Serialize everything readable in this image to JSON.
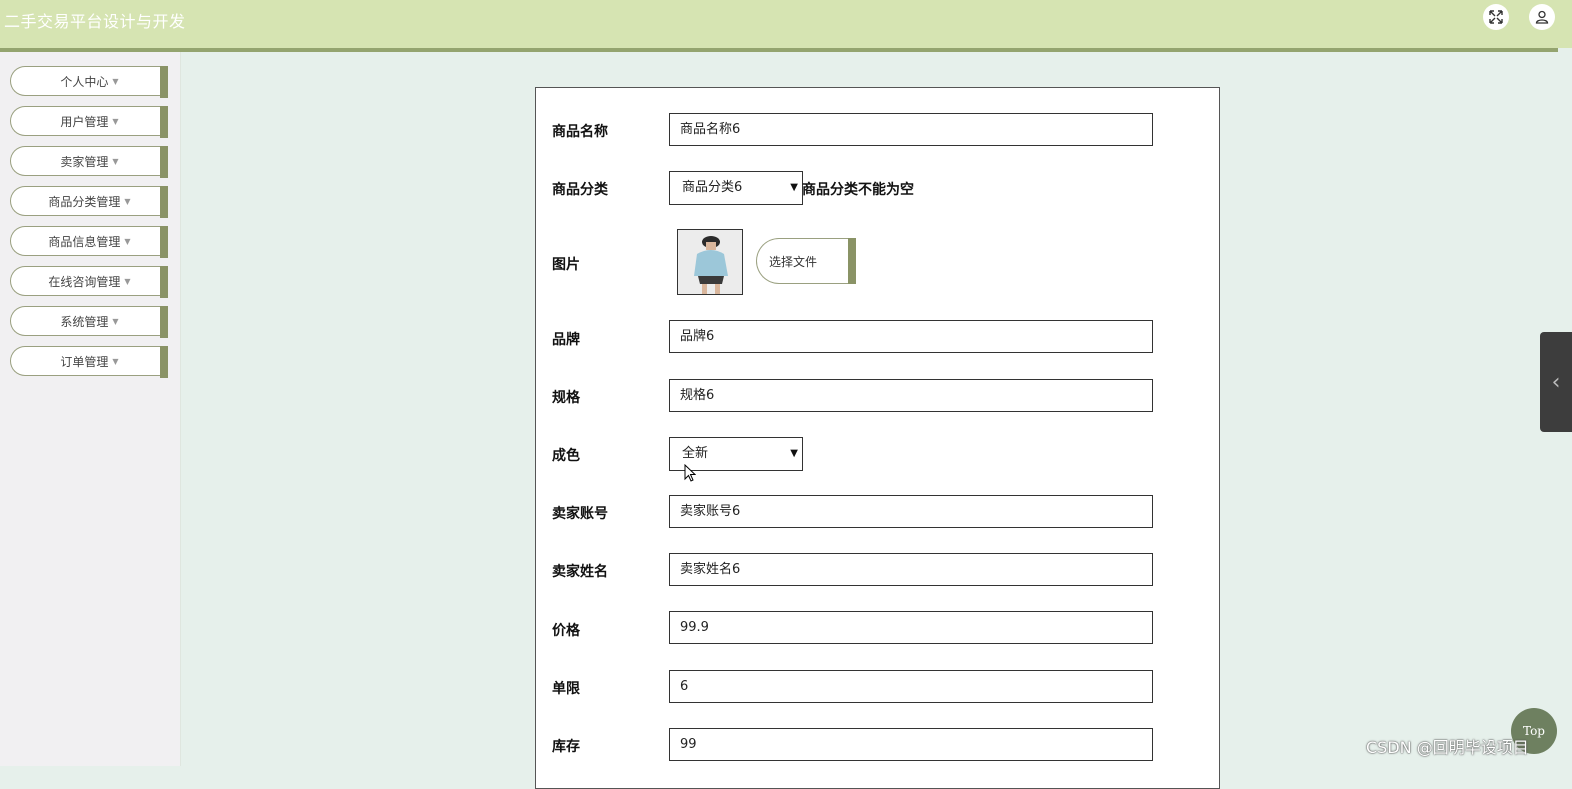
{
  "header": {
    "title": "二手交易平台设计与开发",
    "fullscreen_icon": "expand-arrows-icon",
    "user_icon": "user-icon"
  },
  "sidebar": {
    "items": [
      {
        "label": "个人中心"
      },
      {
        "label": "用户管理"
      },
      {
        "label": "卖家管理"
      },
      {
        "label": "商品分类管理"
      },
      {
        "label": "商品信息管理"
      },
      {
        "label": "在线咨询管理"
      },
      {
        "label": "系统管理"
      },
      {
        "label": "订单管理"
      }
    ]
  },
  "form": {
    "name": {
      "label": "商品名称",
      "value": "商品名称6"
    },
    "category": {
      "label": "商品分类",
      "value": "商品分类6",
      "error": "商品分类不能为空"
    },
    "image": {
      "label": "图片",
      "button": "选择文件"
    },
    "brand": {
      "label": "品牌",
      "value": "品牌6"
    },
    "spec": {
      "label": "规格",
      "value": "规格6"
    },
    "condition": {
      "label": "成色",
      "value": "全新"
    },
    "seller_account": {
      "label": "卖家账号",
      "value": "卖家账号6"
    },
    "seller_name": {
      "label": "卖家姓名",
      "value": "卖家姓名6"
    },
    "price": {
      "label": "价格",
      "value": "99.9"
    },
    "limit": {
      "label": "单限",
      "value": "6"
    },
    "stock": {
      "label": "库存",
      "value": "99"
    }
  },
  "floating": {
    "top_button": "Top",
    "watermark": "CSDN @回明毕设项目"
  },
  "colors": {
    "header_bg": "#d6e4b2",
    "accent": "#8a9366",
    "page_bg": "#e6f0eb",
    "sidebar_bg": "#f1f0f2"
  }
}
